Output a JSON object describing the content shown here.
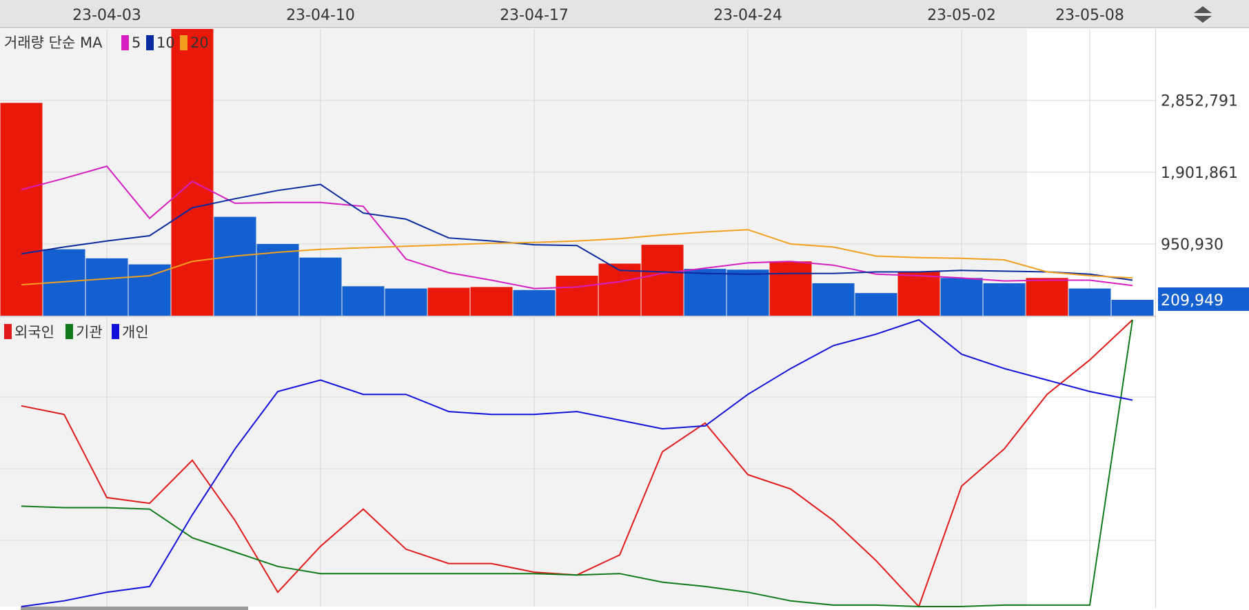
{
  "colors": {
    "volume_up": "#e8190b",
    "volume_down": "#1560d0",
    "ma5": "#d51ec0",
    "ma10": "#0b2a9e",
    "ma20": "#f0a01e",
    "foreign": "#e01a1a",
    "institution": "#0f7a1a",
    "individual": "#1010d8",
    "last_value_bg": "#1560d0",
    "panel_bg": "#f2f2f2",
    "header_bg": "#e4e4e4"
  },
  "header": {
    "scroll_icon": "up-down-arrows-icon"
  },
  "chart_data": [
    {
      "type": "bar",
      "title": "거래량 단순 MA",
      "x_tick_labels": [
        "23-04-03",
        "23-04-10",
        "23-04-17",
        "23-04-24",
        "23-05-02",
        "23-05-08"
      ],
      "x_tick_index": [
        2.5,
        7.5,
        12.5,
        17.5,
        22.5,
        25.5
      ],
      "legend": [
        {
          "name": "5",
          "color": "#d51ec0"
        },
        {
          "name": "10",
          "color": "#0b2a9e"
        },
        {
          "name": "20",
          "color": "#f0a01e"
        }
      ],
      "y_ticks": [
        {
          "value": 2852791,
          "label": "2,852,791"
        },
        {
          "value": 1901861,
          "label": "1,901,861"
        },
        {
          "value": 950930,
          "label": "950,930"
        }
      ],
      "ylim": [
        0,
        3800000
      ],
      "volume": [
        2820000,
        880000,
        760000,
        680000,
        3960000,
        1310000,
        950000,
        770000,
        390000,
        360000,
        370000,
        380000,
        340000,
        530000,
        690000,
        940000,
        620000,
        610000,
        720000,
        430000,
        300000,
        580000,
        500000,
        430000,
        500000,
        360000,
        210000
      ],
      "direction": [
        "up",
        "down",
        "down",
        "down",
        "up",
        "down",
        "down",
        "down",
        "down",
        "down",
        "up",
        "up",
        "down",
        "up",
        "up",
        "up",
        "down",
        "down",
        "up",
        "down",
        "down",
        "up",
        "down",
        "down",
        "up",
        "down",
        "down"
      ],
      "series": [
        {
          "name": "5",
          "key": "ma5",
          "values": [
            1670000,
            1820000,
            1980000,
            1290000,
            1780000,
            1490000,
            1500000,
            1500000,
            1450000,
            750000,
            570000,
            470000,
            360000,
            380000,
            450000,
            560000,
            630000,
            700000,
            720000,
            670000,
            550000,
            530000,
            500000,
            460000,
            470000,
            470000,
            400000
          ]
        },
        {
          "name": "10",
          "key": "ma10",
          "values": [
            820000,
            910000,
            990000,
            1060000,
            1430000,
            1550000,
            1660000,
            1740000,
            1360000,
            1280000,
            1030000,
            990000,
            940000,
            930000,
            600000,
            580000,
            560000,
            550000,
            560000,
            560000,
            580000,
            580000,
            600000,
            590000,
            580000,
            550000,
            470000
          ]
        },
        {
          "name": "20",
          "key": "ma20",
          "values": [
            410000,
            450000,
            490000,
            530000,
            720000,
            790000,
            840000,
            880000,
            900000,
            920000,
            940000,
            960000,
            970000,
            990000,
            1020000,
            1070000,
            1110000,
            1140000,
            950000,
            910000,
            790000,
            770000,
            760000,
            740000,
            580000,
            530000,
            500000
          ]
        }
      ],
      "last_value_label": "209,949",
      "last_value": 209949
    },
    {
      "type": "line",
      "legend": [
        {
          "name": "외국인",
          "color": "#e01a1a"
        },
        {
          "name": "기관",
          "color": "#0f7a1a"
        },
        {
          "name": "개인",
          "color": "#1010d8"
        }
      ],
      "ylim": [
        0,
        100
      ],
      "series": [
        {
          "name": "외국인",
          "key": "foreign",
          "values": [
            70,
            67,
            38,
            36,
            51,
            30,
            5,
            21,
            34,
            20,
            15,
            15,
            12,
            11,
            18,
            54,
            64,
            46,
            41,
            30,
            16,
            0,
            42,
            55,
            74,
            86,
            100
          ]
        },
        {
          "name": "기관",
          "key": "institution",
          "values": [
            35,
            34.5,
            34.5,
            34,
            24,
            19,
            14,
            11.5,
            11.5,
            11.5,
            11.5,
            11.5,
            11.5,
            11,
            11.5,
            8.5,
            7,
            5,
            2,
            0.5,
            0.5,
            0,
            0,
            0.5,
            0.5,
            0.5,
            100
          ]
        },
        {
          "name": "개인",
          "key": "individual",
          "values": [
            0,
            2,
            5,
            7,
            32,
            55,
            75,
            79,
            74,
            74,
            68,
            67,
            67,
            68,
            65,
            62,
            63,
            74,
            83,
            91,
            95,
            100,
            88,
            83,
            79,
            75,
            72
          ]
        }
      ]
    }
  ]
}
